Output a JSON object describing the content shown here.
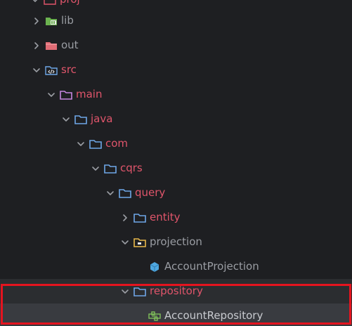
{
  "colors": {
    "background": "#1e1f22",
    "modified_text": "#e0556b",
    "normal_text": "#9a9da3",
    "folder_icon": "#6fa7e8",
    "highlight_border": "#e5141f"
  },
  "tree": {
    "items": [
      {
        "label": "proj",
        "icon": "module-folder-icon",
        "chevron": "down",
        "color": "red"
      },
      {
        "label": "lib",
        "icon": "library-folder-icon",
        "chevron": "right",
        "color": "gray"
      },
      {
        "label": "out",
        "icon": "excluded-folder-icon",
        "chevron": "right",
        "color": "gray"
      },
      {
        "label": "src",
        "icon": "source-folder-icon",
        "chevron": "down",
        "color": "red"
      },
      {
        "label": "main",
        "icon": "folder-icon",
        "chevron": "down",
        "color": "red"
      },
      {
        "label": "java",
        "icon": "folder-icon",
        "chevron": "down",
        "color": "red"
      },
      {
        "label": "com",
        "icon": "folder-icon",
        "chevron": "down",
        "color": "red"
      },
      {
        "label": "cqrs",
        "icon": "folder-icon",
        "chevron": "down",
        "color": "red"
      },
      {
        "label": "query",
        "icon": "folder-icon",
        "chevron": "down",
        "color": "red"
      },
      {
        "label": "entity",
        "icon": "folder-icon",
        "chevron": "right",
        "color": "red"
      },
      {
        "label": "projection",
        "icon": "package-folder-icon",
        "chevron": "down",
        "color": "gray"
      },
      {
        "label": "AccountProjection",
        "icon": "class-cube-icon",
        "chevron": "none",
        "color": "gray"
      },
      {
        "label": "repository",
        "icon": "folder-icon",
        "chevron": "down",
        "color": "red"
      },
      {
        "label": "AccountRepository",
        "icon": "interface-repository-icon",
        "chevron": "none",
        "color": "light"
      }
    ]
  }
}
